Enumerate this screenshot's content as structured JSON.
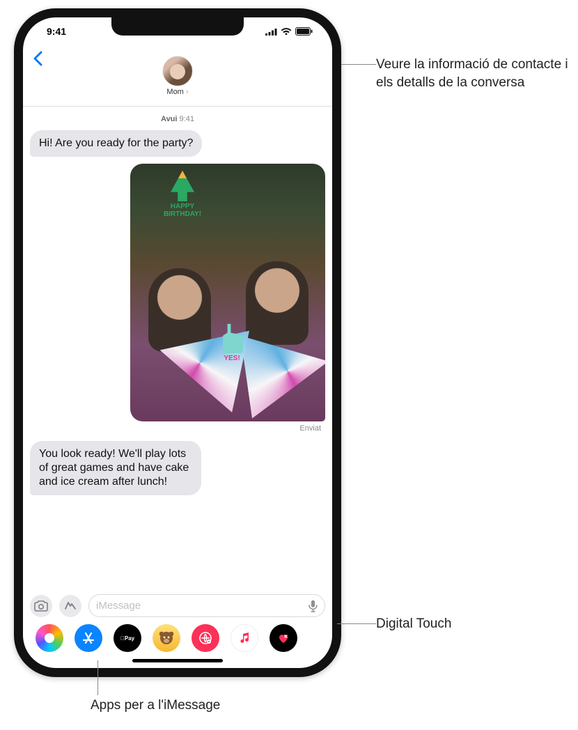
{
  "statusbar": {
    "time": "9:41"
  },
  "nav": {
    "contact_name": "Mom"
  },
  "thread": {
    "timestamp_day": "Avui",
    "timestamp_time": "9:41",
    "msg1": "Hi! Are you ready for the party?",
    "sticker_pine_label": "HAPPY BIRTHDAY!",
    "sticker_llama_label": "YES!",
    "sent_status": "Enviat",
    "msg2": "You look ready! We'll play lots of great games and have cake and ice cream after lunch!"
  },
  "input": {
    "placeholder": "iMessage"
  },
  "apps": {
    "pay_label": "Pay"
  },
  "callouts": {
    "contact": "Veure la informació de contacte i els detalls de la conversa",
    "dtouch": "Digital Touch",
    "appstore": "Apps per a l'iMessage"
  }
}
